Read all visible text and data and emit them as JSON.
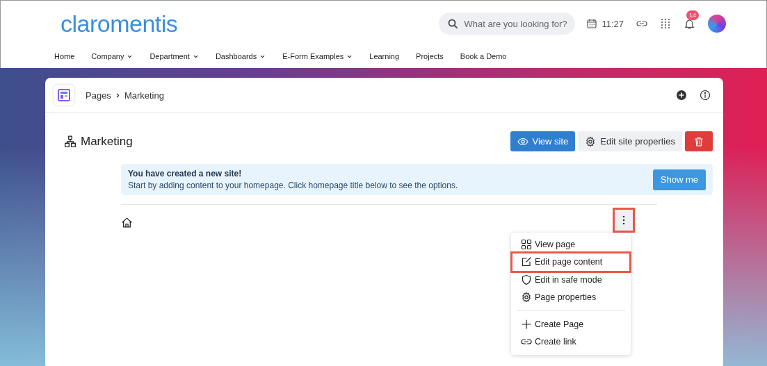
{
  "header": {
    "logo": "claromentis",
    "search": {
      "placeholder": "What are you looking for?"
    },
    "time": "11:27",
    "notifications": "14"
  },
  "nav": [
    {
      "label": "Home",
      "dropdown": false
    },
    {
      "label": "Company",
      "dropdown": true
    },
    {
      "label": "Department",
      "dropdown": true
    },
    {
      "label": "Dashboards",
      "dropdown": true
    },
    {
      "label": "E-Form Examples",
      "dropdown": true
    },
    {
      "label": "Learning",
      "dropdown": false
    },
    {
      "label": "Projects",
      "dropdown": false
    },
    {
      "label": "Book a Demo",
      "dropdown": false
    }
  ],
  "breadcrumb": [
    "Pages",
    "Marketing"
  ],
  "site": {
    "title": "Marketing",
    "buttons": [
      {
        "label": "View site",
        "kind": "primary"
      },
      {
        "label": "Edit site properties",
        "kind": "secondary"
      },
      {
        "kind": "danger"
      }
    ]
  },
  "alert": {
    "title": "You have created a new site!",
    "text": "Start by adding content to your homepage. Click homepage title below to see the options.",
    "button": "Show me"
  },
  "kebab": {
    "highlighted": true
  },
  "menu": [
    {
      "kind": "item",
      "label": "View page",
      "highlighted": false
    },
    {
      "kind": "item",
      "label": "Edit page content",
      "highlighted": true
    },
    {
      "kind": "item",
      "label": "Edit in safe mode",
      "highlighted": false
    },
    {
      "kind": "item",
      "label": "Page properties",
      "highlighted": false
    },
    {
      "kind": "divider"
    },
    {
      "kind": "item",
      "label": "Create Page",
      "highlighted": false
    },
    {
      "kind": "item",
      "label": "Create link",
      "highlighted": false
    }
  ]
}
